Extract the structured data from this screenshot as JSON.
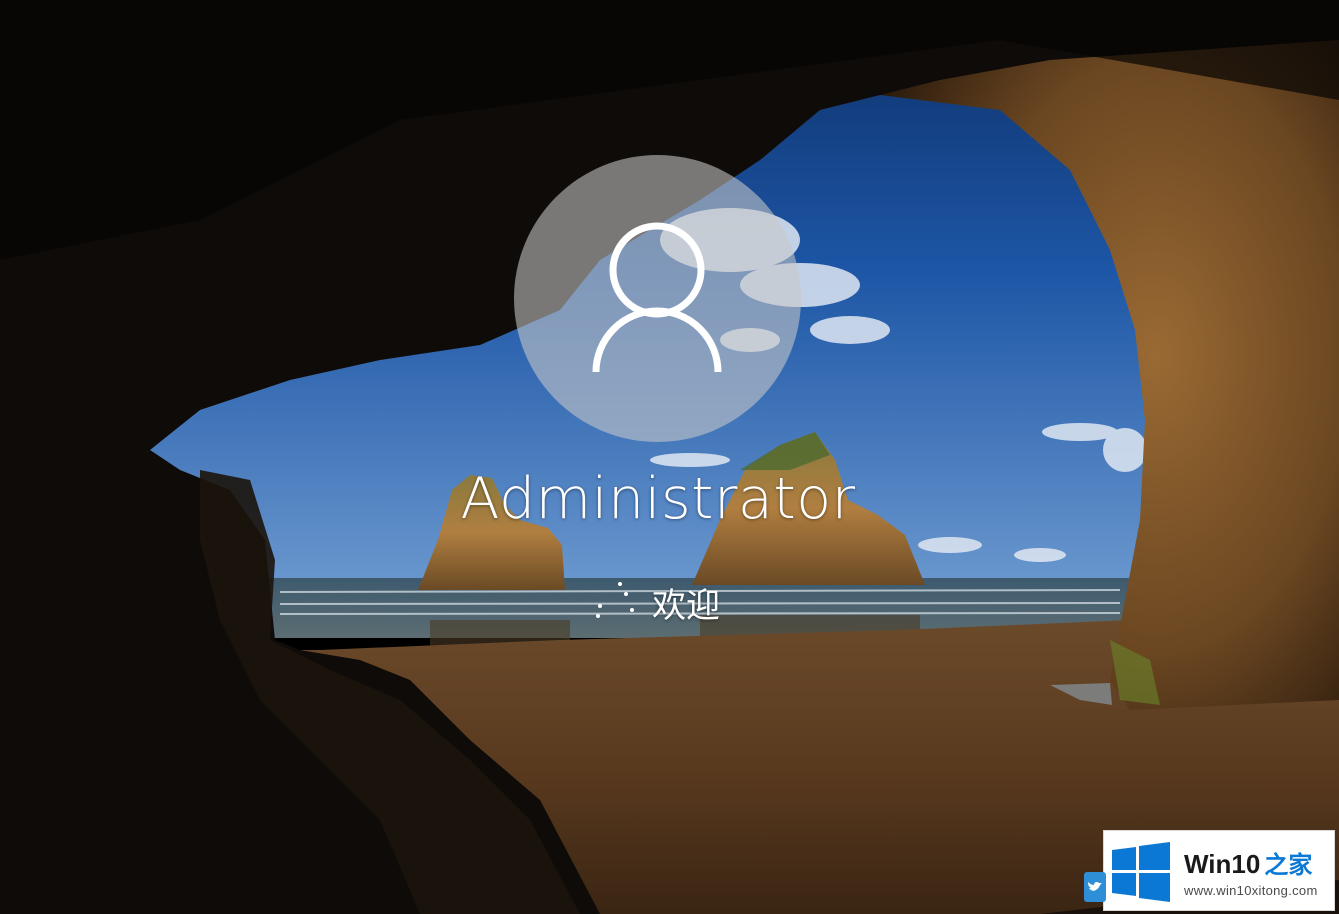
{
  "user": {
    "name": "Administrator",
    "avatar_icon": "user-silhouette-icon"
  },
  "status": {
    "text": "欢迎",
    "spinner_icon": "loading-dots-icon"
  },
  "watermark": {
    "name": "Win10",
    "suffix": "之家",
    "url": "www.win10xitong.com",
    "logo_icon": "windows-logo-icon",
    "brand_color": "#0a78d4"
  },
  "corner_icon": "twitter-bird-icon"
}
